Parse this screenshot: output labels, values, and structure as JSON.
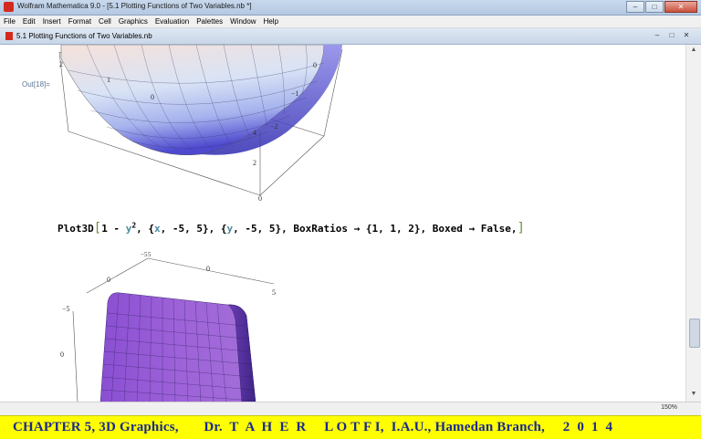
{
  "window": {
    "title": "Wolfram Mathematica 9.0 - [5.1 Plotting Functions of Two Variables.nb *]",
    "controls": [
      "–",
      "□",
      "✕"
    ]
  },
  "menubar": [
    "File",
    "Edit",
    "Insert",
    "Format",
    "Cell",
    "Graphics",
    "Evaluation",
    "Palettes",
    "Window",
    "Help"
  ],
  "notebook": {
    "title": "5.1 Plotting Functions of Two Variables.nb",
    "controls": [
      "–",
      "□",
      "✕"
    ]
  },
  "output_label": "Out[18]=",
  "plot1": {
    "ticks_front": [
      "2",
      "1",
      "0"
    ],
    "ticks_right": [
      "0",
      "−1",
      "−2"
    ],
    "ticks_vertical": [
      "4",
      "2",
      "0"
    ]
  },
  "input": {
    "func": "Plot3D",
    "open": "[",
    "expr1": "1 - ",
    "var_y": "y",
    "sup": "2",
    "sep1": ", {",
    "var_x": "x",
    "range1": ", -5, 5}, {",
    "var_y2": "y",
    "range2": ", -5, 5}, ",
    "opt1": "BoxRatios",
    "arrow1": " → ",
    "val1": "{1, 1, 2}, ",
    "opt2": "Boxed",
    "arrow2": " → ",
    "val2": "False,",
    "close": "]"
  },
  "plot2": {
    "ticks_top": [
      "−5",
      "5",
      "0",
      "0",
      "5"
    ],
    "ticks_left": [
      "−5",
      "0"
    ]
  },
  "statusbar": {
    "zoom": "150%"
  },
  "footer": {
    "text": "CHAPTER 5, 3D Graphics,       Dr.  T  A  H  E  R     L O T F I,  I.A.U., Hamedan Branch,     2  0  1  4"
  },
  "colors": {
    "footer_bg": "#ffff00",
    "footer_text": "#1a2a8c",
    "surface1_top": "#f3d9d2",
    "surface1_bottom": "#5b57d6",
    "surface2": "#8d52d0"
  }
}
